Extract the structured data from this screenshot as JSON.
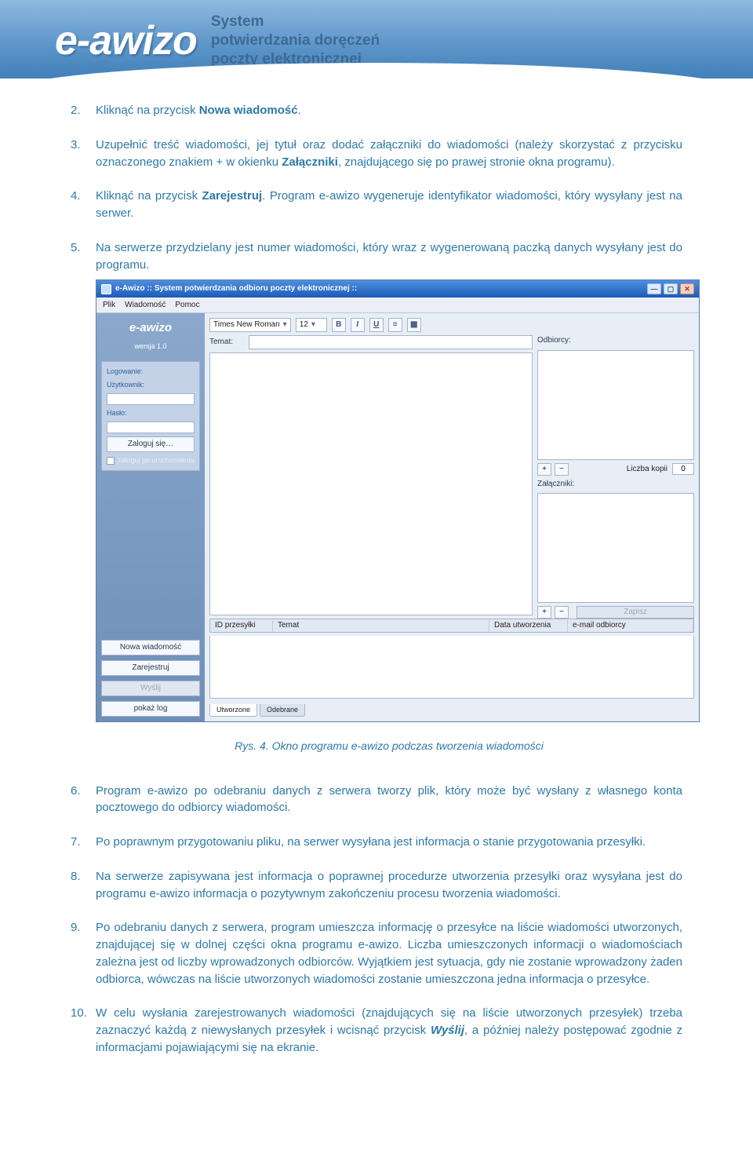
{
  "banner": {
    "logo": "e-awizo",
    "tagline_l1": "System",
    "tagline_l2": "potwierdzania doręczeń",
    "tagline_l3": "poczty elektronicznej"
  },
  "steps": {
    "s2_a": "Kliknąć na przycisk ",
    "s2_b": "Nowa wiadomość",
    "s2_c": ".",
    "s3_a": "Uzupełnić treść wiadomości, jej tytuł oraz dodać załączniki do wiadomości (należy skorzystać z przycisku oznaczonego znakiem + w okienku ",
    "s3_b": "Załączniki",
    "s3_c": ", znajdującego się po prawej stronie okna programu).",
    "s4_a": "Kliknąć na przycisk ",
    "s4_b": "Zarejestruj",
    "s4_c": ". Program e-awizo wygeneruje identyfikator wiadomości, który wysyłany jest na serwer.",
    "s5": "Na serwerze przydzielany jest numer wiadomości, który wraz z wygenerowaną paczką danych wysyłany jest do programu.",
    "s6": "Program e-awizo po odebraniu danych z serwera tworzy plik, który może być wysłany z własnego konta pocztowego do odbiorcy wiadomości.",
    "s7": "Po poprawnym przygotowaniu pliku, na serwer wysyłana jest informacja o stanie przygotowania przesyłki.",
    "s8": "Na serwerze zapisywana jest informacja o poprawnej procedurze utworzenia przesyłki oraz wysyłana jest do programu e-awizo informacja o pozytywnym zakończeniu procesu tworzenia wiadomości.",
    "s9": "Po odebraniu danych z serwera, program umieszcza informację o przesyłce na liście wiadomości utworzonych, znajdującej się w dolnej części okna programu e-awizo. Liczba umieszczonych informacji o wiadomościach zależna jest od liczby wprowadzonych odbiorców. Wyjątkiem jest sytuacja, gdy nie zostanie wprowadzony żaden odbiorca, wówczas na liście utworzonych wiadomości zostanie umieszczona jedna informacja o przesyłce.",
    "s10_a": "W celu wysłania zarejestrowanych wiadomości (znajdujących się na liście utworzonych przesyłek) trzeba zaznaczyć każdą z niewysłanych przesyłek i wcisnąć przycisk ",
    "s10_b": "Wyślij",
    "s10_c": ", a później należy postępować zgodnie z informacjami pojawiającymi się na ekranie."
  },
  "caption": "Rys. 4. Okno programu e-awizo podczas tworzenia wiadomości",
  "app": {
    "title": "e-Awizo :: System potwierdzania odbioru poczty elektronicznej ::",
    "menus": [
      "Plik",
      "Wiadomość",
      "Pomoc"
    ],
    "sidebar": {
      "brand": "e-awizo",
      "version": "wersja 1.0",
      "login_header": "Logowanie:",
      "user_label": "Użytkownik:",
      "pass_label": "Hasło:",
      "login_btn": "Zaloguj się…",
      "remember": "zaloguj po uruchomieniu",
      "btn_new": "Nowa wiadomość",
      "btn_register": "Zarejestruj",
      "btn_send": "Wyślij",
      "btn_log": "pokaż log"
    },
    "toolbar": {
      "font": "Times New Roman",
      "size": "12",
      "b": "B",
      "i": "I",
      "u": "U"
    },
    "labels": {
      "temat": "Temat:",
      "odbiorcy": "Odbiorcy:",
      "zalaczniki": "Załączniki:",
      "liczba_kopii": "Liczba kopii",
      "zapisz": "Zapisz"
    },
    "liczba_kopii_value": "0",
    "grid": {
      "id": "ID przesyłki",
      "temat": "Temat",
      "data": "Data utworzenia",
      "email": "e-mail odbiorcy"
    },
    "tabs": {
      "utworzone": "Utworzone",
      "odebrane": "Odebrane"
    }
  }
}
